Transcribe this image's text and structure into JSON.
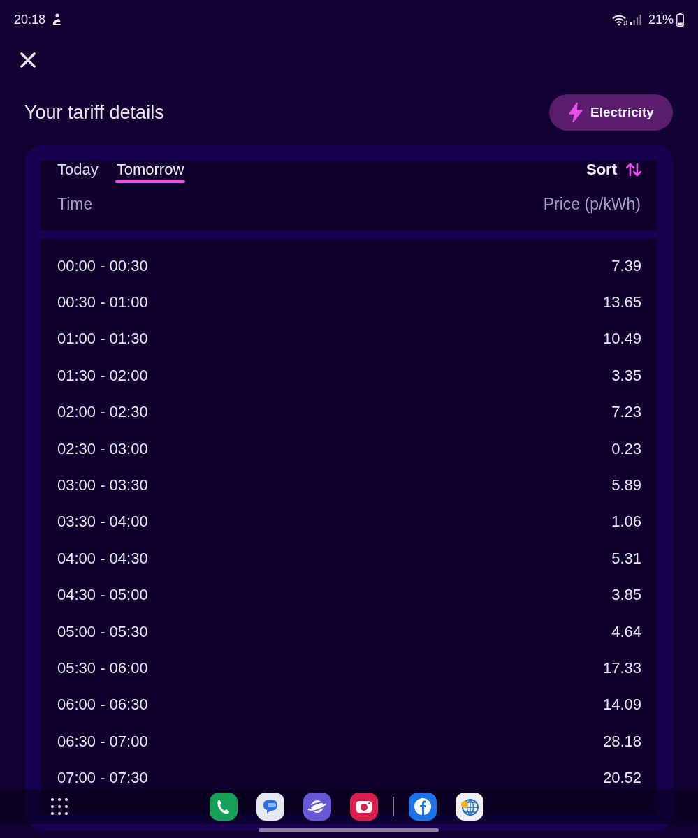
{
  "status_bar": {
    "time": "20:18",
    "battery": "21%"
  },
  "header": {
    "title": "Your tariff details",
    "fuel_button": "Electricity"
  },
  "tabs": [
    {
      "label": "Today",
      "selected": false
    },
    {
      "label": "Tomorrow",
      "selected": true
    }
  ],
  "sort": {
    "label": "Sort"
  },
  "table": {
    "columns": [
      "Time",
      "Price (p/kWh)"
    ],
    "rows": [
      {
        "time": "00:00 - 00:30",
        "price": "7.39"
      },
      {
        "time": "00:30 - 01:00",
        "price": "13.65"
      },
      {
        "time": "01:00 - 01:30",
        "price": "10.49"
      },
      {
        "time": "01:30 - 02:00",
        "price": "3.35"
      },
      {
        "time": "02:00 - 02:30",
        "price": "7.23"
      },
      {
        "time": "02:30 - 03:00",
        "price": "0.23"
      },
      {
        "time": "03:00 - 03:30",
        "price": "5.89"
      },
      {
        "time": "03:30 - 04:00",
        "price": "1.06"
      },
      {
        "time": "04:00 - 04:30",
        "price": "5.31"
      },
      {
        "time": "04:30 - 05:00",
        "price": "3.85"
      },
      {
        "time": "05:00 - 05:30",
        "price": "4.64"
      },
      {
        "time": "05:30 - 06:00",
        "price": "17.33"
      },
      {
        "time": "06:00 - 06:30",
        "price": "14.09"
      },
      {
        "time": "06:30 - 07:00",
        "price": "28.18"
      },
      {
        "time": "07:00 - 07:30",
        "price": "20.52"
      }
    ]
  }
}
